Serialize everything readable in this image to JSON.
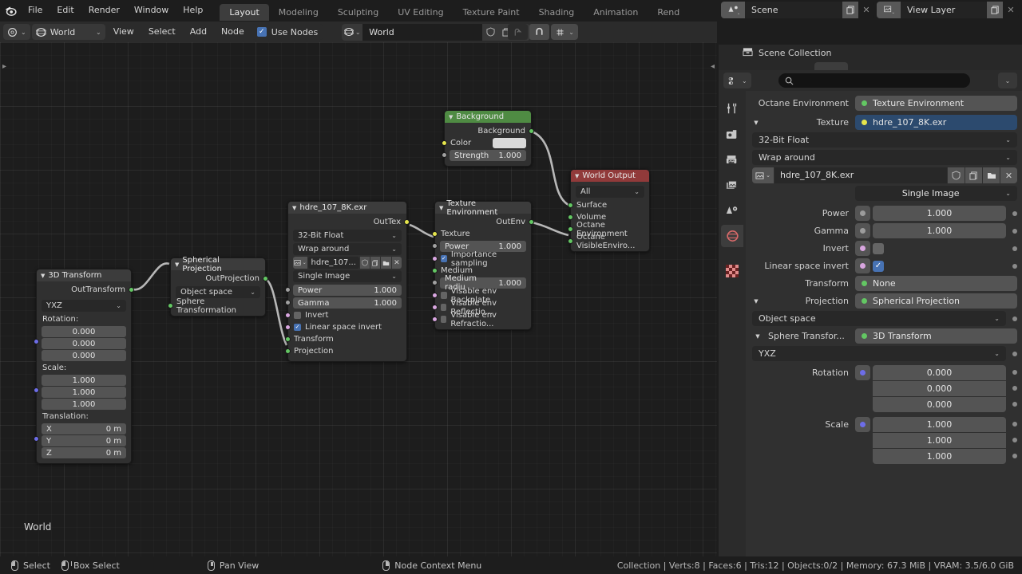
{
  "topbar": {
    "menus": [
      "File",
      "Edit",
      "Render",
      "Window",
      "Help"
    ],
    "workspaces": [
      {
        "label": "Layout",
        "active": true
      },
      {
        "label": "Modeling",
        "active": false
      },
      {
        "label": "Sculpting",
        "active": false
      },
      {
        "label": "UV Editing",
        "active": false
      },
      {
        "label": "Texture Paint",
        "active": false
      },
      {
        "label": "Shading",
        "active": false
      },
      {
        "label": "Animation",
        "active": false
      },
      {
        "label": "Rend",
        "active": false
      }
    ],
    "scene_name": "Scene",
    "view_layer_name": "View Layer"
  },
  "node_header": {
    "editor_type_icon": "node-editor-icon",
    "shader_type": "World",
    "menus": [
      "View",
      "Select",
      "Add",
      "Node"
    ],
    "use_nodes_label": "Use Nodes",
    "use_nodes_checked": true,
    "world_datablock": "World",
    "snap_icon": "snap-magnet-icon",
    "proportional_icon": "proportional-edit-icon"
  },
  "canvas": {
    "breadcrumb_label": "World"
  },
  "nodes": {
    "background": {
      "title": "Background",
      "header_color": "#4f8b43",
      "outputs": [
        {
          "label": "Background",
          "color": "s-green"
        }
      ],
      "color_label": "Color",
      "strength_label": "Strength",
      "strength_value": "1.000"
    },
    "world_output": {
      "title": "World Output",
      "header_color": "#913a3a",
      "target": "All",
      "inputs": [
        "Surface",
        "Volume",
        "Octane Environment",
        "Octane VisibleEnviro..."
      ]
    },
    "texture_environment": {
      "title": "Texture Environment",
      "output_label": "OutEnv",
      "texture_label": "Texture",
      "power_label": "Power",
      "power_value": "1.000",
      "importance_label": "Importance sampling",
      "importance_checked": true,
      "medium_label": "Medium",
      "medium_radius_label": "Medium radiu",
      "medium_radius_value": "1.000",
      "backplate_label": "Visable env Backplate",
      "backplate_checked": false,
      "reflection_label": "Visable env Reflectio...",
      "reflection_checked": false,
      "refraction_label": "Visable env Refractio...",
      "refraction_checked": false
    },
    "image_texture": {
      "title": "hdre_107_8K.exr",
      "output_label": "OutTex",
      "bit_depth": "32-Bit Float",
      "wrap_mode": "Wrap around",
      "image_name": "hdre_107...",
      "source": "Single Image",
      "power_label": "Power",
      "power_value": "1.000",
      "gamma_label": "Gamma",
      "gamma_value": "1.000",
      "invert_label": "Invert",
      "invert_checked": false,
      "linear_invert_label": "Linear space invert",
      "linear_invert_checked": true,
      "transform_label": "Transform",
      "projection_label": "Projection"
    },
    "spherical_projection": {
      "title": "Spherical Projection",
      "output_label": "OutProjection",
      "coordinate_space": "Object space",
      "input_label": "Sphere Transformation"
    },
    "transform_3d": {
      "title": "3D Transform",
      "output_label": "OutTransform",
      "rotation_order": "YXZ",
      "rotation_label": "Rotation:",
      "rotation": [
        "0.000",
        "0.000",
        "0.000"
      ],
      "scale_label": "Scale:",
      "scale": [
        "1.000",
        "1.000",
        "1.000"
      ],
      "translation_label": "Translation:",
      "translation": [
        {
          "axis": "X",
          "value": "0 m"
        },
        {
          "axis": "Y",
          "value": "0 m"
        },
        {
          "axis": "Z",
          "value": "0 m"
        }
      ]
    }
  },
  "outliner": {
    "root_label": "Scene Collection",
    "root_icon": "collection-icon"
  },
  "properties": {
    "search_placeholder": "",
    "tabs": [
      {
        "name": "tool-tab",
        "icon": "tool-icon",
        "active": false
      },
      {
        "name": "render-tab",
        "icon": "render-camera-icon",
        "active": false
      },
      {
        "name": "output-tab",
        "icon": "printer-icon",
        "active": false
      },
      {
        "name": "view-layer-tab",
        "icon": "images-icon",
        "active": false
      },
      {
        "name": "scene-tab",
        "icon": "scene-cone-icon",
        "active": false
      },
      {
        "name": "world-tab",
        "icon": "world-globe-icon",
        "active": true
      },
      {
        "name": "texture-tab",
        "icon": "checker-texture-icon",
        "active": false
      }
    ],
    "rows": {
      "octane_environment_label": "Octane Environment",
      "octane_environment_value": "Texture Environment",
      "texture_label": "Texture",
      "texture_value": "hdre_107_8K.exr",
      "bit_depth": "32-Bit Float",
      "wrap_mode": "Wrap around",
      "image_name": "hdre_107_8K.exr",
      "source": "Single Image",
      "power_label": "Power",
      "power_value": "1.000",
      "gamma_label": "Gamma",
      "gamma_value": "1.000",
      "invert_label": "Invert",
      "invert_checked": false,
      "linear_invert_label": "Linear space invert",
      "linear_invert_checked": true,
      "transform_label": "Transform",
      "transform_value": "None",
      "projection_label": "Projection",
      "projection_value": "Spherical Projection",
      "coordinate_space": "Object space",
      "sphere_transform_label": "Sphere Transfor...",
      "sphere_transform_value": "3D Transform",
      "rotation_order": "YXZ",
      "rotation_label": "Rotation",
      "rotation": [
        "0.000",
        "0.000",
        "0.000"
      ],
      "scale_label": "Scale",
      "scale": [
        "1.000",
        "1.000",
        "1.000"
      ]
    }
  },
  "status_bar": {
    "hints": [
      {
        "icon": "mouse-left-icon",
        "label": "Select"
      },
      {
        "icon": "mouse-left-drag-icon",
        "label": "Box Select"
      },
      {
        "icon": "mouse-middle-icon",
        "label": "Pan View"
      },
      {
        "icon": "mouse-right-icon",
        "label": "Node Context Menu"
      }
    ],
    "stats": "Collection | Verts:8 | Faces:6 | Tris:12 | Objects:0/2 | Memory: 67.3 MiB | VRAM: 3.5/6.0 GiB"
  }
}
